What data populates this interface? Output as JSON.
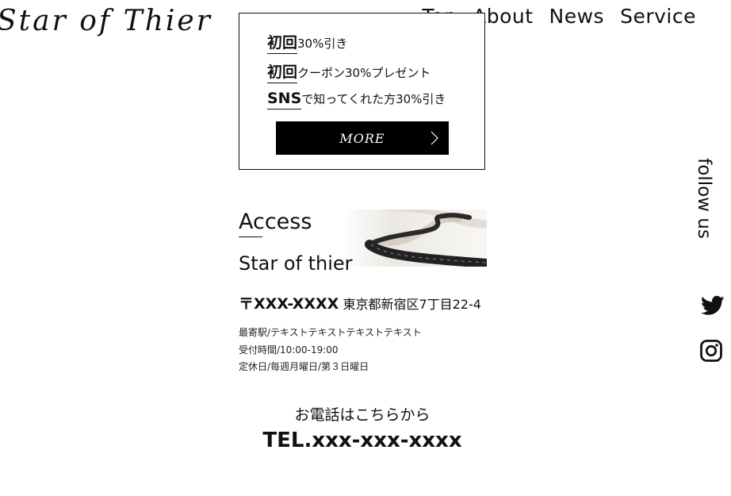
{
  "header": {
    "logo": "Star of Thier",
    "nav": [
      "Top",
      "About",
      "News",
      "Service"
    ]
  },
  "promo": {
    "lines": [
      {
        "emphasis": "初回",
        "text": "30%引き"
      },
      {
        "emphasis": "初回",
        "text": "クーポン30%プレゼント"
      },
      {
        "emphasis": "SNS",
        "text": "で知ってくれた方30%引き"
      }
    ],
    "more_label": "MORE"
  },
  "access": {
    "title": "Access",
    "name": "Star of thier",
    "zip": "〒XXX-XXXX",
    "address": "東京都新宿区7丁目22-4",
    "info": [
      "最寄駅/テキストテキストテキストテキスト",
      "受付時間/10:00-19:00",
      "定休日/毎週月曜日/第３日曜日"
    ]
  },
  "contact": {
    "caption": "お電話はこちらから",
    "tel": "TEL.xxx-xxx-xxxx"
  },
  "sidebar": {
    "follow_label": "follow us",
    "icons": [
      "twitter-icon",
      "instagram-icon"
    ]
  }
}
